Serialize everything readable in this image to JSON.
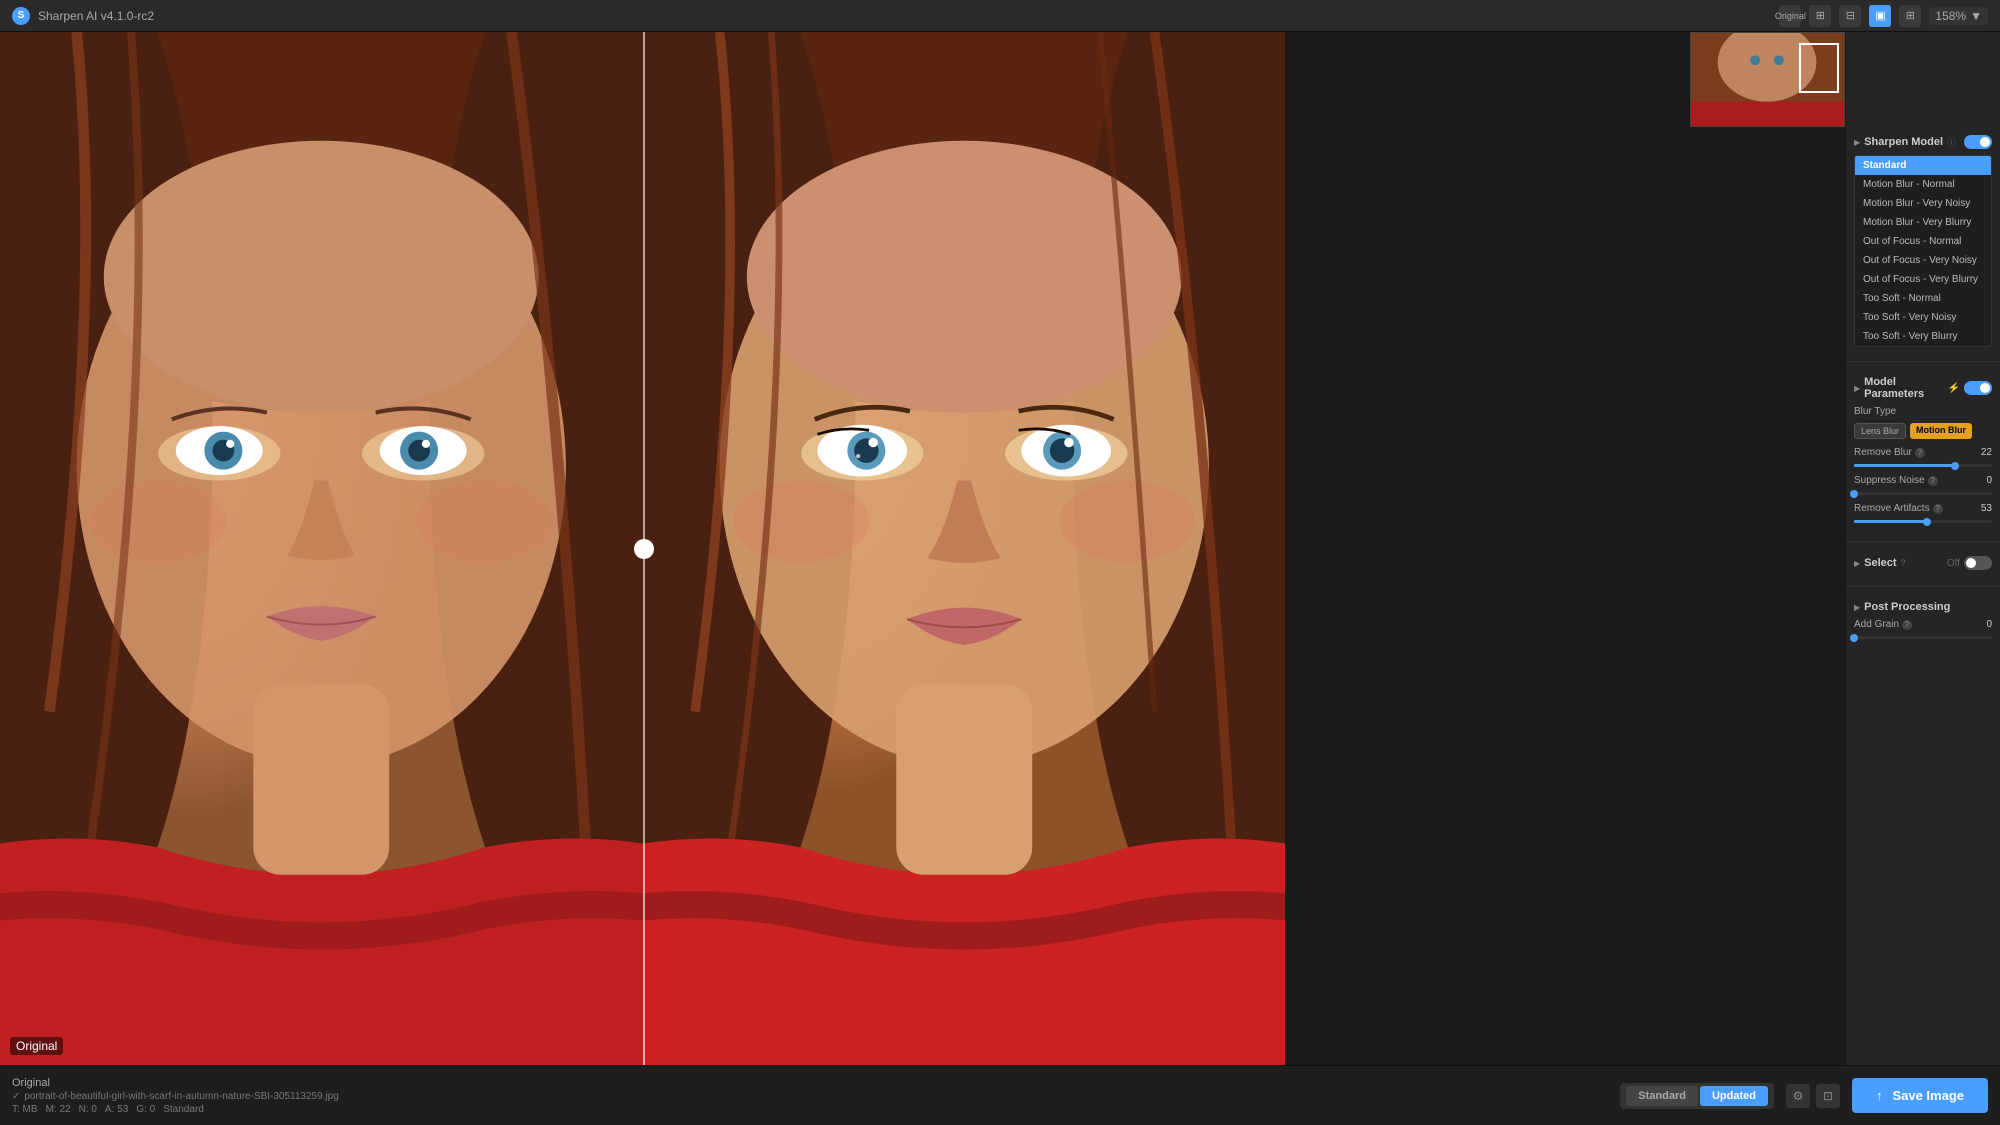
{
  "app": {
    "name": "Sharpen AI v4.1.0-rc2",
    "icon": "S",
    "zoom": "158%"
  },
  "toolbar": {
    "original_label": "Original",
    "zoom_label": "158%"
  },
  "image": {
    "left_label": "Original",
    "filename": "portrait-of-beautiful-girl-with-scarf-in-autumn-nature-SBI-305113259.jpg"
  },
  "panel": {
    "sharpen_model": {
      "title": "Sharpen Model",
      "models": [
        {
          "id": "standard",
          "label": "Standard",
          "selected": true
        },
        {
          "id": "motion-blur-normal",
          "label": "Motion Blur - Normal",
          "selected": false
        },
        {
          "id": "motion-blur-very-noisy",
          "label": "Motion Blur - Very Noisy",
          "selected": false
        },
        {
          "id": "motion-blur-very-blurry",
          "label": "Motion Blur - Very Blurry",
          "selected": false
        },
        {
          "id": "out-of-focus-normal",
          "label": "Out of Focus - Normal",
          "selected": false
        },
        {
          "id": "out-of-focus-very-noisy",
          "label": "Out of Focus - Very Noisy",
          "selected": false
        },
        {
          "id": "out-of-focus-very-blurry",
          "label": "Out of Focus - Very Blurry",
          "selected": false
        },
        {
          "id": "too-soft-normal",
          "label": "Too Soft - Normal",
          "selected": false
        },
        {
          "id": "too-soft-very-noisy",
          "label": "Too Soft - Very Noisy",
          "selected": false
        },
        {
          "id": "too-soft-very-blurry",
          "label": "Too Soft - Very Blurry",
          "selected": false
        }
      ]
    },
    "model_parameters": {
      "title": "Model Parameters",
      "blur_type_label": "Blur Type",
      "lens_blur_label": "Lens Blur",
      "motion_blur_label": "Motion Blur",
      "remove_blur_label": "Remove Blur",
      "remove_blur_value": 22,
      "remove_blur_pct": 73,
      "suppress_noise_label": "Suppress Noise",
      "suppress_noise_value": 0,
      "suppress_noise_pct": 0,
      "remove_artifacts_label": "Remove Artifacts",
      "remove_artifacts_value": 53,
      "remove_artifacts_pct": 53
    },
    "select": {
      "title": "Select",
      "value": "Off"
    },
    "post_processing": {
      "title": "Post Processing",
      "add_grain_label": "Add Grain",
      "add_grain_value": 0,
      "add_grain_pct": 0
    }
  },
  "statusbar": {
    "label": "Original",
    "filename_prefix": "✓",
    "filename": "portrait-of-beautiful-girl-with-scarf-in-autumn-nature-SBI-305113259.jpg",
    "meta_t": "T: MB",
    "meta_m": "M: 22",
    "meta_n": "N: 0",
    "meta_a": "A: 53",
    "meta_g": "G: 0",
    "model": "Standard",
    "standard_label": "Standard",
    "updated_label": "Updated",
    "save_label": "↑ Save Image"
  }
}
